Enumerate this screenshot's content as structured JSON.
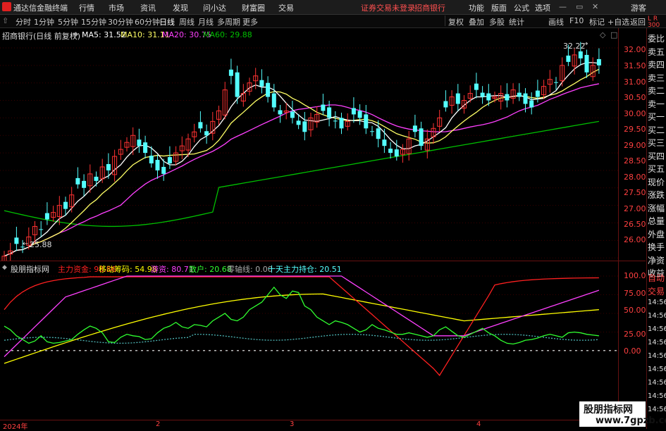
{
  "app": {
    "name": "通达信金融终端",
    "notice": "证券交易未登录",
    "stock": "招商银行"
  },
  "menu": [
    "行情",
    "市场",
    "资讯",
    "发现",
    "问小达",
    "财富圈",
    "交易"
  ],
  "right_menu": [
    "功能",
    "版面",
    "公式",
    "选项"
  ],
  "guest": "游客",
  "timeframes": [
    "分时",
    "1分钟",
    "5分钟",
    "15分钟",
    "30分钟",
    "60分钟",
    "日线",
    "周线",
    "月线",
    "多周期",
    "更多"
  ],
  "active_timeframe": "日线",
  "toolbar_right": [
    "复权",
    "叠加",
    "多股",
    "统计",
    "画线",
    "F10",
    "标记",
    "+自选",
    "返回"
  ],
  "main_legend": {
    "title": "招商银行(日线 前复权)",
    "ma5": "MA5: 31.52",
    "ma10": "MA10: 31.11",
    "ma20": "MA20: 30.75",
    "ma60": "MA60: 29.88"
  },
  "price_axis": [
    "32.00",
    "31.50",
    "31.00",
    "30.50",
    "30.00",
    "29.50",
    "29.00",
    "28.50",
    "28.00",
    "27.50",
    "27.00",
    "26.50",
    "26.00"
  ],
  "high_label": "32.22",
  "low_label": "25.88",
  "ind_legend": {
    "name": "股朋指标网",
    "l1": "主力资金: 98.86",
    "l2": "移动筹码: 54.98",
    "l3": "游资: 80.71",
    "l4": "散户: 20.68",
    "l5": "零轴线: 0.00",
    "l6": "十天主力持仓: 20.51"
  },
  "ind_axis": [
    "100.0",
    "75.00",
    "50.00",
    "25.00",
    "0.00"
  ],
  "side_panel": [
    "委比",
    "卖五",
    "卖四",
    "卖三",
    "卖二",
    "卖一",
    "买一",
    "买二",
    "买三",
    "买四",
    "买五",
    "现价",
    "涨跌",
    "涨幅",
    "总量",
    "外盘",
    "换手",
    "净资",
    "收益"
  ],
  "side_bottom": [
    "自动",
    "交易",
    "14:56",
    "14:56",
    "14:56",
    "14:56",
    "14:56",
    "14:56",
    "14:56",
    "14:56",
    "14:56"
  ],
  "dates": [
    "2024年",
    "2",
    "3",
    "4"
  ],
  "watermark": {
    "line1": "股朋指标网",
    "line2": "www.7gpzb.com"
  },
  "colors": {
    "up": "#ff3232",
    "down": "#54ffff",
    "ma5": "#ffffff",
    "ma10": "#ffff66",
    "ma20": "#ff40ff",
    "ma60": "#00c000",
    "main_fund": "#ff2020",
    "move_chip": "#ffff00",
    "hot_money": "#ff40ff",
    "retail": "#30ff30"
  }
}
